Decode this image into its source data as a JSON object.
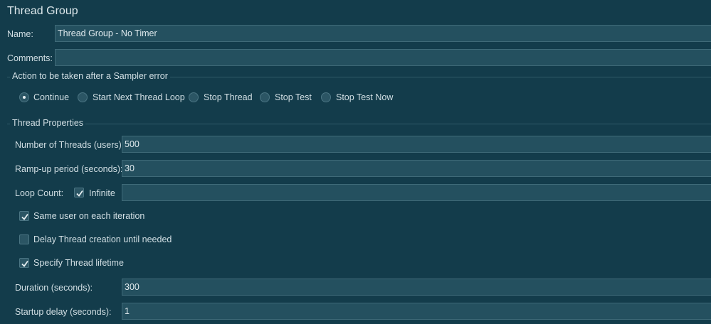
{
  "panel": {
    "title": "Thread Group"
  },
  "name_field": {
    "label": "Name:",
    "value": "Thread Group - No Timer"
  },
  "comments_field": {
    "label": "Comments:",
    "value": ""
  },
  "sampler_error": {
    "title": "Action to be taken after a Sampler error",
    "options": [
      {
        "label": "Continue",
        "selected": true
      },
      {
        "label": "Start Next Thread Loop",
        "selected": false
      },
      {
        "label": "Stop Thread",
        "selected": false
      },
      {
        "label": "Stop Test",
        "selected": false
      },
      {
        "label": "Stop Test Now",
        "selected": false
      }
    ]
  },
  "thread_properties": {
    "title": "Thread Properties",
    "num_threads": {
      "label": "Number of Threads (users):",
      "value": "500"
    },
    "ramp_up": {
      "label": "Ramp-up period (seconds):",
      "value": "30"
    },
    "loop_count": {
      "label": "Loop Count:",
      "infinite_label": "Infinite",
      "infinite_checked": true,
      "value": ""
    },
    "same_user": {
      "label": "Same user on each iteration",
      "checked": true
    },
    "delay_creation": {
      "label": "Delay Thread creation until needed",
      "checked": false
    },
    "specify_lifetime": {
      "label": "Specify Thread lifetime",
      "checked": true
    },
    "duration": {
      "label": "Duration (seconds):",
      "value": "300"
    },
    "startup_delay": {
      "label": "Startup delay (seconds):",
      "value": "1"
    }
  },
  "colors": {
    "background": "#133c4b",
    "field": "#24505f",
    "text": "#d6e2e7"
  }
}
